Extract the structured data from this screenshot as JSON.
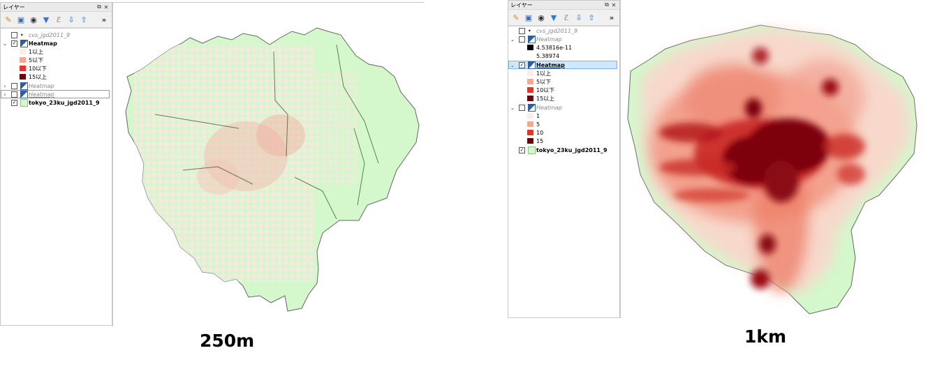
{
  "left": {
    "panel_title": "レイヤー",
    "caption": "250m",
    "layers": {
      "cvs": "cvs_jgd2011_9",
      "heat1": "Heatmap",
      "heat1_items": [
        "1以上",
        "5以下",
        "10以下",
        "15以上"
      ],
      "heat2": "Heatmap",
      "heat3": "Heatmap",
      "tokyo": "tokyo_23ku_jgd2011_9"
    }
  },
  "right": {
    "panel_title": "レイヤー",
    "caption": "1km",
    "layers": {
      "cvs": "cvs_jgd2011_9",
      "heat1": "Heatmap",
      "heat1_items": [
        "4.53816e-11",
        "5.38974"
      ],
      "heat2": "Heatmap",
      "heat2_items": [
        "1以上",
        "5以下",
        "10以下",
        "15以上"
      ],
      "heat3": "Heatmap",
      "heat3_items": [
        "1",
        "5",
        "10",
        "15"
      ],
      "tokyo": "tokyo_23ku_jgd2011_9"
    }
  },
  "colors": {
    "land": "#d4f7cc",
    "heat_low": "#fde3dc",
    "heat_mid": "#ef3b2c",
    "heat_high": "#67000d",
    "swatch_1": "#fdeee8",
    "swatch_5": "#f6a78e",
    "swatch_10": "#e8312a",
    "swatch_15": "#6b0010"
  }
}
